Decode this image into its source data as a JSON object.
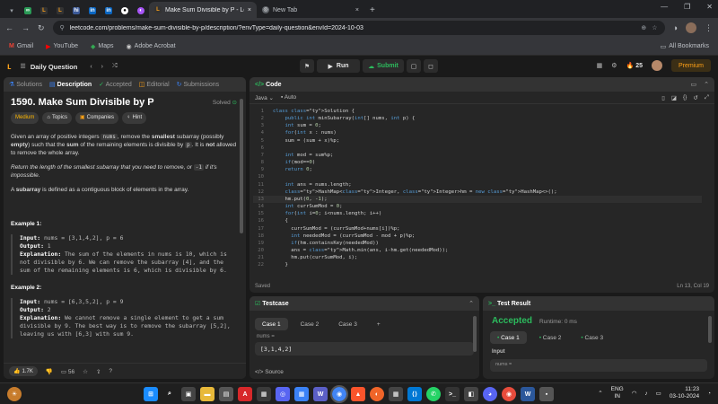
{
  "browser": {
    "tabs": [
      {
        "label": "Make Sum Divisible by P - Leet",
        "active": true
      },
      {
        "label": "New Tab",
        "active": false
      }
    ],
    "url": "leetcode.com/problems/make-sum-divisible-by-p/description/?envType=daily-question&envId=2024-10-03",
    "bookmarks": [
      "Gmail",
      "YouTube",
      "Maps",
      "Adobe Acrobat"
    ],
    "all_bookmarks": "All Bookmarks"
  },
  "nav": {
    "daily": "Daily Question",
    "run": "Run",
    "submit": "Submit",
    "streak": "25",
    "premium": "Premium"
  },
  "problem": {
    "tabs": [
      "Solutions",
      "Description",
      "Accepted",
      "Editorial",
      "Submissions"
    ],
    "title": "1590. Make Sum Divisible by P",
    "status": "Solved",
    "difficulty": "Medium",
    "chips": [
      "Topics",
      "Companies",
      "Hint"
    ],
    "p1a": "Given an array of positive integers ",
    "p1code": "nums",
    "p1b": ", remove the ",
    "p1bold": "smallest",
    "p1c": " subarray (possibly ",
    "p1bold2": "empty",
    "p1d": ") such that the ",
    "p1bold3": "sum",
    "p1e": " of the remaining elements is divisible by ",
    "p1code2": "p",
    "p1f": ". It is ",
    "p1bold4": "not",
    "p1g": " allowed to remove the whole array.",
    "p2a": "Return the length of the smallest subarray that you need to remove, or ",
    "p2code": "-1",
    "p2b": " if it's impossible.",
    "p3a": "A ",
    "p3bold": "subarray",
    "p3b": " is defined as a contiguous block of elements in the array.",
    "ex1_title": "Example 1:",
    "ex1_input": "nums = [3,1,4,2], p = 6",
    "ex1_output": "1",
    "ex1_expl": "The sum of the elements in nums is 10, which is not divisible by 6. We can remove the subarray [4], and the sum of the remaining elements is 6, which is divisible by 6.",
    "ex2_title": "Example 2:",
    "ex2_input": "nums = [6,3,5,2], p = 9",
    "ex2_output": "2",
    "ex2_expl": "We cannot remove a single element to get a sum divisible by 9. The best way is to remove the subarray [5,2], leaving us with [6,3] with sum 9.",
    "label_input": "Input:",
    "label_output": "Output:",
    "label_expl": "Explanation:",
    "likes": "1.7K",
    "comments": "56"
  },
  "editor": {
    "title": "Code",
    "lang": "Java",
    "auto": "Auto",
    "saved": "Saved",
    "cursor": "Ln 13, Col 19",
    "lines": [
      "class Solution {",
      "    public int minSubarray(int[] nums, int p) {",
      "    int sum = 0;",
      "    for(int x : nums)",
      "    sum = (sum + x)%p;",
      "",
      "    int mod = sum%p;",
      "    if(mod==0)",
      "    return 0;",
      "",
      "    int ans = nums.length;",
      "    HashMap<Integer, Integer>hm = new HashMap<>();",
      "    hm.put(0, -1);",
      "    int currSumMod = 0;",
      "    for(int i=0; i<nums.length; i++)",
      "    {",
      "      currSumMod = (currSumMod+nums[i])%p;",
      "      int neededMod = (currSumMod - mod + p)%p;",
      "      if(hm.containsKey(neededMod))",
      "      ans = Math.min(ans, i-hm.get(neededMod));",
      "      hm.put(currSumMod, i);",
      "    }"
    ]
  },
  "testcase": {
    "title": "Testcase",
    "cases": [
      "Case 1",
      "Case 2",
      "Case 3"
    ],
    "var_label": "nums =",
    "var_value": "[3,1,4,2]",
    "source": "Source"
  },
  "result": {
    "title": "Test Result",
    "status": "Accepted",
    "runtime": "Runtime: 0 ms",
    "cases": [
      "Case 1",
      "Case 2",
      "Case 3"
    ],
    "input_label": "Input",
    "nums_label": "nums ="
  },
  "taskbar": {
    "lang": "ENG",
    "region": "IN",
    "time": "11:23",
    "date": "03-10-2024"
  }
}
